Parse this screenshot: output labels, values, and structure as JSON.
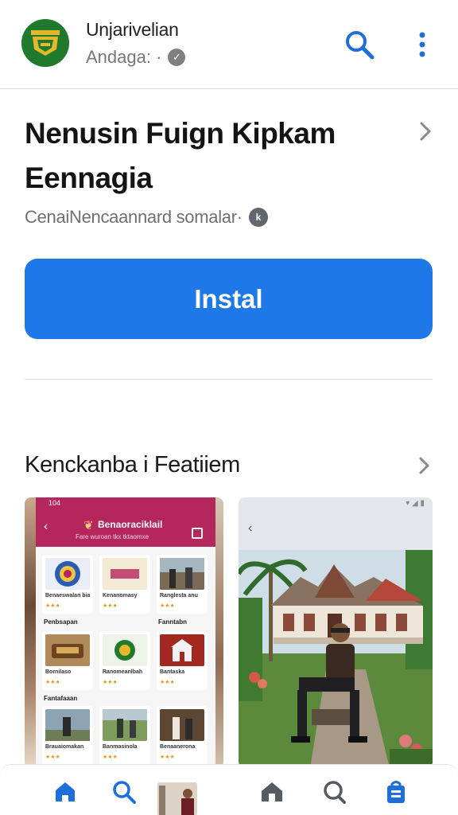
{
  "app": {
    "name": "Unjarivelian",
    "subtitle": "Andaga: ·"
  },
  "listing": {
    "title_line1": "Nenusin Fuign  Kipkam",
    "title_line2": "Eennagia",
    "developer": "CenaiNencaannard somalar·",
    "install_label": "Instal"
  },
  "section": {
    "title": "Kenckanba i Featiiem"
  },
  "screenshot1": {
    "status_time": "104",
    "header_title": "Benaoraciklail",
    "header_sub": "Fare wuroan tkx  tktaomxe",
    "cards": [
      {
        "title": "Benaeswalan bia",
        "stars": "★★★"
      },
      {
        "title": "Kenanomasy",
        "stars": "★★★"
      },
      {
        "title": "Ranglesta anu",
        "stars": "★★★"
      },
      {
        "title": "Bornilaso",
        "stars": "★★★"
      },
      {
        "title": "Ranomeanlbah",
        "stars": "★★★"
      },
      {
        "title": "Bantaska",
        "stars": "★★★"
      },
      {
        "title": "Brauaiomakan",
        "stars": "★★★"
      },
      {
        "title": "Banmasinola",
        "stars": "★★★"
      },
      {
        "title": "Benaanerona",
        "stars": "★★★"
      }
    ],
    "label_row2": "Penbsapan",
    "label_row2b": "Fanntabn",
    "label_row3": "Fantafaaan"
  },
  "colors": {
    "accent": "#1e78e8",
    "header_magenta": "#b5265c",
    "nav_blue": "#1e6fd9",
    "nav_gray": "#555b63"
  },
  "icons": {
    "top": [
      "search-icon",
      "more-vertical-icon"
    ],
    "nav": [
      "home-icon",
      "search-icon",
      "home-outline-icon",
      "search-outline-icon",
      "shopping-bag-icon"
    ]
  }
}
